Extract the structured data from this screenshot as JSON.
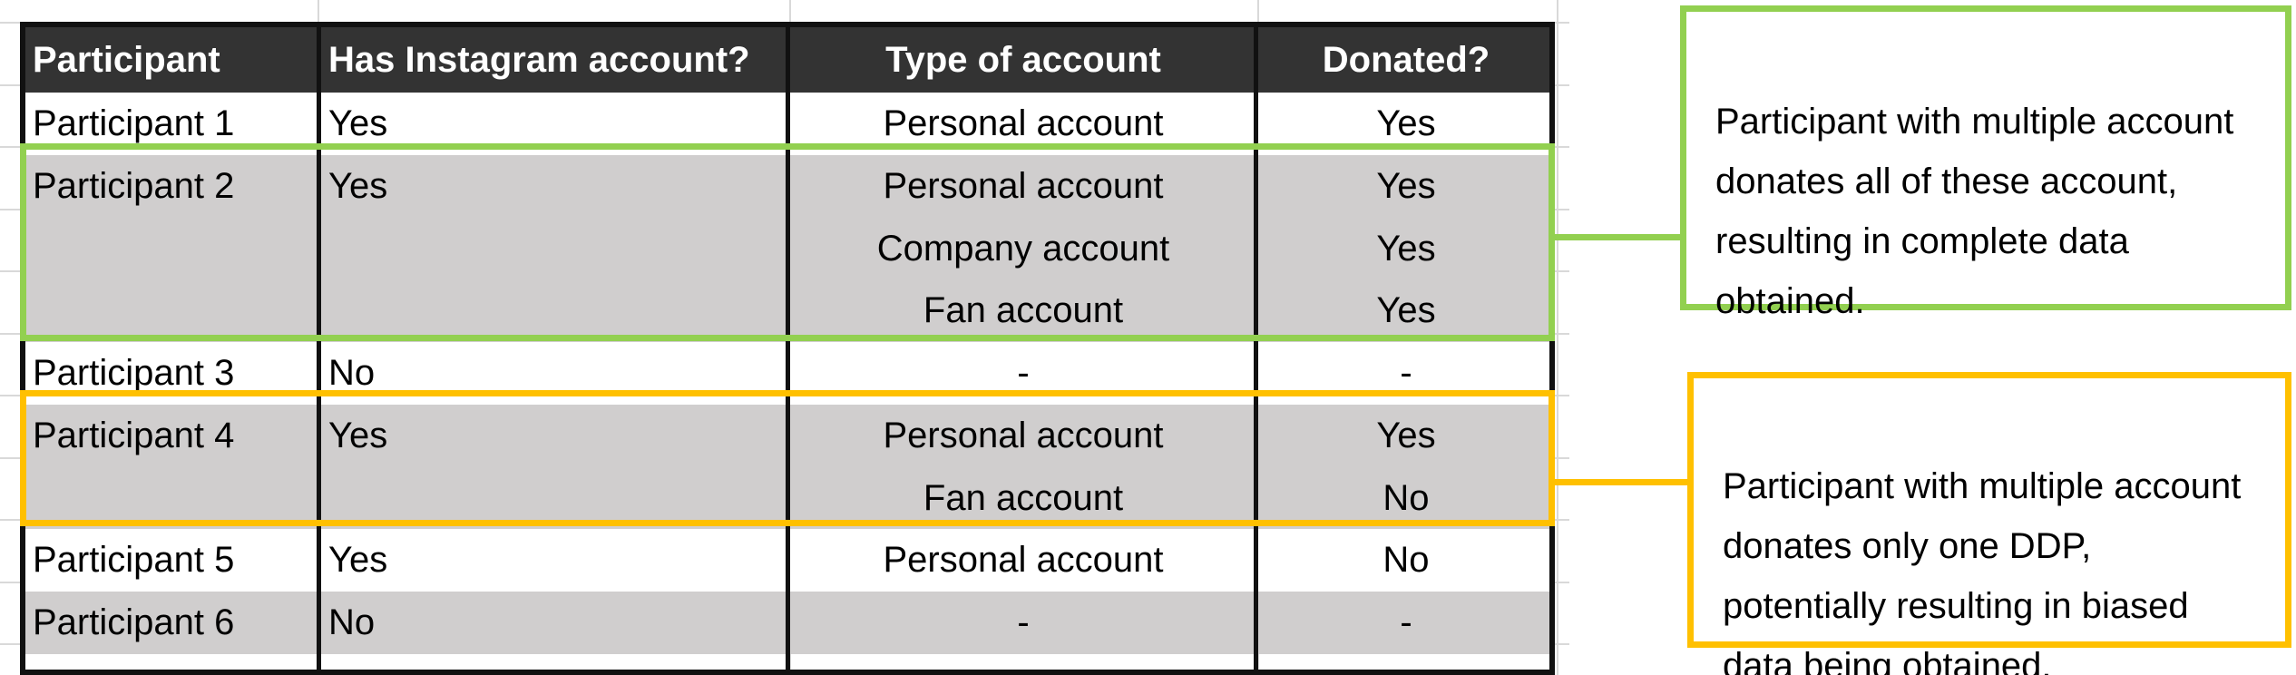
{
  "table": {
    "headers": [
      "Participant",
      "Has Instagram account?",
      "Type of account",
      "Donated?"
    ],
    "rows": [
      {
        "participant": "Participant 1",
        "has_account": "Yes",
        "accounts": [
          "Personal account"
        ],
        "donated": [
          "Yes"
        ]
      },
      {
        "participant": "Participant 2",
        "has_account": "Yes",
        "accounts": [
          "Personal account",
          "Company account",
          "Fan account"
        ],
        "donated": [
          "Yes",
          "Yes",
          "Yes"
        ]
      },
      {
        "participant": "Participant 3",
        "has_account": "No",
        "accounts": [
          "-"
        ],
        "donated": [
          "-"
        ]
      },
      {
        "participant": "Participant 4",
        "has_account": "Yes",
        "accounts": [
          "Personal account",
          "Fan account"
        ],
        "donated": [
          "Yes",
          "No"
        ]
      },
      {
        "participant": "Participant 5",
        "has_account": "Yes",
        "accounts": [
          "Personal account"
        ],
        "donated": [
          "No"
        ]
      },
      {
        "participant": "Participant 6",
        "has_account": "No",
        "accounts": [
          "-"
        ],
        "donated": [
          "-"
        ]
      }
    ]
  },
  "callouts": {
    "complete": "Participant with multiple account donates all of these account, resulting in complete data obtained.",
    "biased": "Participant with multiple account donates only one DDP, potentially resulting in biased data being obtained."
  },
  "colors": {
    "header_bg": "#333333",
    "shaded_row": "#d0cece",
    "green_highlight": "#92d050",
    "yellow_highlight": "#ffc000",
    "border": "#111111"
  }
}
